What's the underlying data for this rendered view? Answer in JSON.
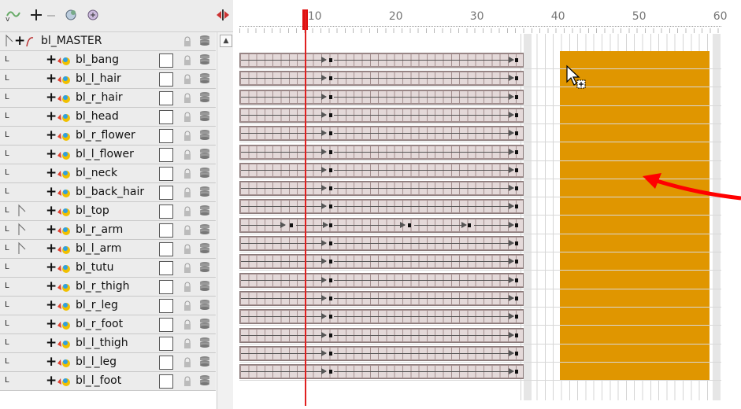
{
  "toolbar": {
    "icons": [
      "add-drawing-icon",
      "add-peg-icon",
      "collapse-icon",
      "add-effect-icon",
      "add-group-icon",
      "sound-scrubbing-icon"
    ]
  },
  "layers": [
    {
      "name": "bl_MASTER",
      "type": "master",
      "expander": true
    },
    {
      "name": "bl_bang",
      "type": "drawing"
    },
    {
      "name": "bl_l_hair",
      "type": "drawing"
    },
    {
      "name": "bl_r_hair",
      "type": "drawing"
    },
    {
      "name": "bl_head",
      "type": "drawing"
    },
    {
      "name": "bl_r_flower",
      "type": "drawing"
    },
    {
      "name": "bl_l_flower",
      "type": "drawing"
    },
    {
      "name": "bl_neck",
      "type": "drawing"
    },
    {
      "name": "bl_back_hair",
      "type": "drawing"
    },
    {
      "name": "bl_top",
      "type": "drawing",
      "expander": true
    },
    {
      "name": "bl_r_arm",
      "type": "drawing",
      "expander": true
    },
    {
      "name": "bl_l_arm",
      "type": "drawing",
      "expander": true
    },
    {
      "name": "bl_tutu",
      "type": "drawing"
    },
    {
      "name": "bl_r_thigh",
      "type": "drawing"
    },
    {
      "name": "bl_r_leg",
      "type": "drawing"
    },
    {
      "name": "bl_r_foot",
      "type": "drawing"
    },
    {
      "name": "bl_l_thigh",
      "type": "drawing"
    },
    {
      "name": "bl_l_leg",
      "type": "drawing"
    },
    {
      "name": "bl_l_foot",
      "type": "drawing"
    }
  ],
  "ruler": {
    "labels": [
      "10",
      "20",
      "30",
      "40",
      "50",
      "60"
    ]
  },
  "timeline": {
    "current_frame": 9,
    "exposed_frames": [
      1,
      35
    ],
    "selection_frames": [
      41,
      58
    ],
    "selection_color": "#e09600",
    "playhead_color": "#e02020"
  }
}
